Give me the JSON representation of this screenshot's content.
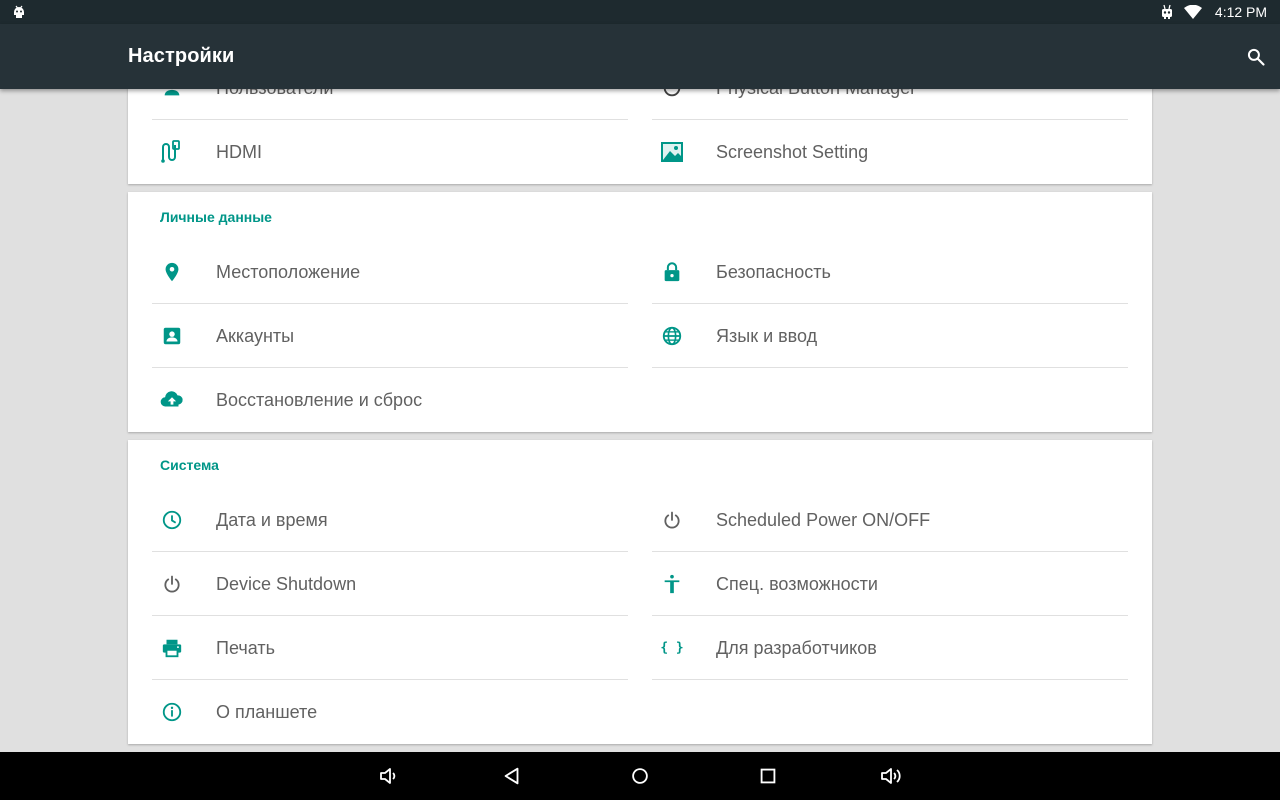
{
  "status_bar": {
    "time": "4:12 PM",
    "icons": [
      "android-icon",
      "notification-robot-icon",
      "wifi-icon"
    ]
  },
  "toolbar": {
    "title": "Настройки",
    "search_icon": "search-icon"
  },
  "colors": {
    "accent": "#009688",
    "toolbar": "#263238",
    "status_bar": "#1e2a2f",
    "background": "#e0e0e0",
    "text": "#616161"
  },
  "sections": [
    {
      "title": "",
      "items": [
        {
          "label": "Пользователи",
          "icon": "users-icon"
        },
        {
          "label": "Physical Button Manager",
          "icon": "button-manager-icon"
        },
        {
          "label": "HDMI",
          "icon": "hdmi-icon"
        },
        {
          "label": "Screenshot Setting",
          "icon": "screenshot-icon"
        }
      ]
    },
    {
      "title": "Личные данные",
      "items": [
        {
          "label": "Местоположение",
          "icon": "location-icon"
        },
        {
          "label": "Безопасность",
          "icon": "lock-icon"
        },
        {
          "label": "Аккаунты",
          "icon": "account-icon"
        },
        {
          "label": "Язык и ввод",
          "icon": "globe-icon"
        },
        {
          "label": "Восстановление и сброс",
          "icon": "cloud-upload-icon"
        }
      ]
    },
    {
      "title": "Система",
      "items": [
        {
          "label": "Дата и время",
          "icon": "clock-icon"
        },
        {
          "label": "Scheduled Power ON/OFF",
          "icon": "power-icon"
        },
        {
          "label": "Device Shutdown",
          "icon": "power-icon"
        },
        {
          "label": "Спец. возможности",
          "icon": "accessibility-icon"
        },
        {
          "label": "Печать",
          "icon": "print-icon"
        },
        {
          "label": "Для разработчиков",
          "icon": "developer-braces-icon"
        },
        {
          "label": "О планшете",
          "icon": "info-icon"
        }
      ]
    }
  ],
  "nav_bar": [
    "volume-down-icon",
    "back-icon",
    "home-icon",
    "recents-icon",
    "volume-up-icon"
  ]
}
